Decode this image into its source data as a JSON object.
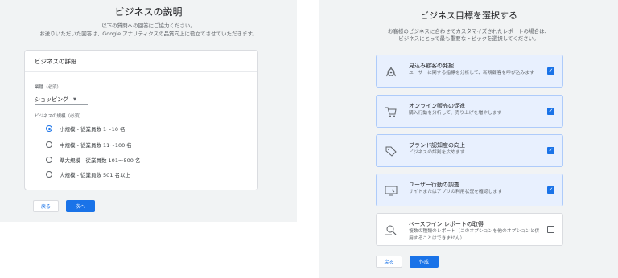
{
  "left": {
    "title": "ビジネスの説明",
    "subtitle_line1": "以下の質問への回答にご協力ください。",
    "subtitle_line2": "お送りいただいた回答は、Google アナリティクスの品質向上に役立てさせていただきます。",
    "card_title": "ビジネスの詳細",
    "industry_label": "業種（必須）",
    "industry_value": "ショッピング",
    "size_label": "ビジネスの規模（必須）",
    "size_options": [
      {
        "label": "小規模 - 従業員数 1～10 名",
        "selected": true
      },
      {
        "label": "中規模 - 従業員数 11～100 名",
        "selected": false
      },
      {
        "label": "準大規模 - 従業員数 101～500 名",
        "selected": false
      },
      {
        "label": "大規模 - 従業員数 501 名以上",
        "selected": false
      }
    ],
    "back_label": "戻る",
    "next_label": "次へ"
  },
  "right": {
    "title": "ビジネス目標を選択する",
    "subtitle_line1": "お客様のビジネスに合わせてカスタマイズされたレポートの場合は、",
    "subtitle_line2": "ビジネスにとって最も重要なトピックを選択してください。",
    "goals": [
      {
        "title": "見込み顧客の発掘",
        "desc": "ユーザーに関する指標を分析して、新規顧客を呼び込みます",
        "checked": true,
        "icon": "target-icon"
      },
      {
        "title": "オンライン販売の促進",
        "desc": "購入行動を分析して、売り上げを増やします",
        "checked": true,
        "icon": "cart-icon"
      },
      {
        "title": "ブランド認知度の向上",
        "desc": "ビジネスの評判を広めます",
        "checked": true,
        "icon": "tag-icon"
      },
      {
        "title": "ユーザー行動の調査",
        "desc": "サイトまたはアプリの利用状況を確認します",
        "checked": true,
        "icon": "screen-icon"
      },
      {
        "title": "ベースライン レポートの取得",
        "desc": "複数の種類のレポート（このオプションを他のオプションと併用することはできません）",
        "checked": false,
        "icon": "magnifier-icon"
      }
    ],
    "back_label": "戻る",
    "create_label": "作成"
  },
  "colors": {
    "accent": "#1a73e8",
    "selected_bg": "#e8f0fe",
    "selected_border": "#aecbfa",
    "panel_bg": "#f1f3f4"
  }
}
